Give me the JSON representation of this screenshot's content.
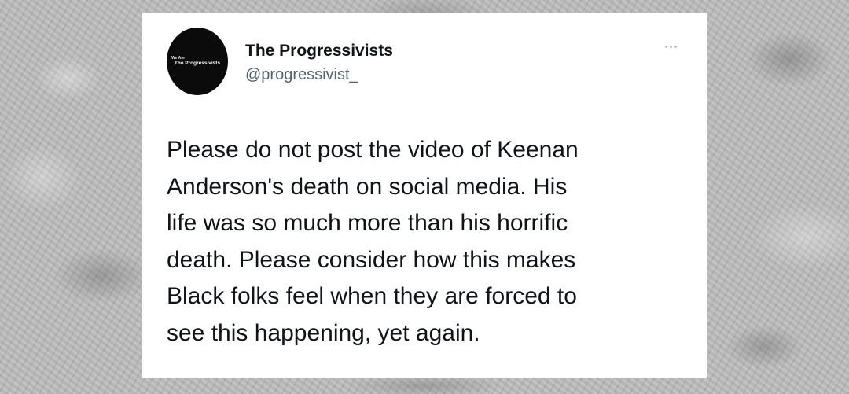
{
  "account": {
    "avatar_small_text": "We Are",
    "avatar_main_text": "The Progressivists",
    "display_name": "The Progressivists",
    "handle": "@progressivist_"
  },
  "menu": {
    "icon": "more-horizontal-icon"
  },
  "tweet": {
    "lines": [
      "Please do not post the video of Keenan",
      "Anderson's death on social media. His",
      "life was so much more than his horrific",
      "death. Please consider how this makes",
      "Black folks feel when they are forced to",
      "see this happening, yet again."
    ]
  },
  "colors": {
    "card_background": "#ffffff",
    "name_text": "#0f1419",
    "handle_text": "#536471",
    "avatar_background": "#0b0b0b",
    "page_background": "#bdbdbd"
  }
}
